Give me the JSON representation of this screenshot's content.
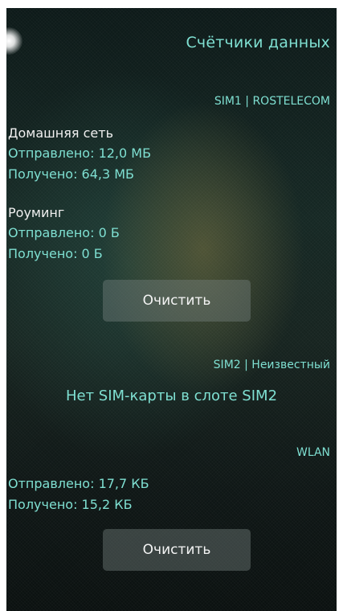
{
  "header": {
    "title": "Счётчики данных"
  },
  "sim1": {
    "header": "SIM1 | ROSTELECOM",
    "home": {
      "label": "Домашняя сеть",
      "sent": "Отправлено: 12,0 МБ",
      "received": "Получено: 64,3 МБ"
    },
    "roaming": {
      "label": "Роуминг",
      "sent": "Отправлено: 0 Б",
      "received": "Получено: 0 Б"
    },
    "clear_label": "Очистить"
  },
  "sim2": {
    "header": "SIM2 | Неизвестный",
    "message": "Нет SIM-карты в слоте SIM2"
  },
  "wlan": {
    "header": "WLAN",
    "sent": "Отправлено: 17,7 КБ",
    "received": "Получено: 15,2 КБ",
    "clear_label": "Очистить"
  },
  "colors": {
    "accent": "#7fe0d2",
    "text": "#f0f0f0",
    "button_bg": "#5f6866"
  }
}
